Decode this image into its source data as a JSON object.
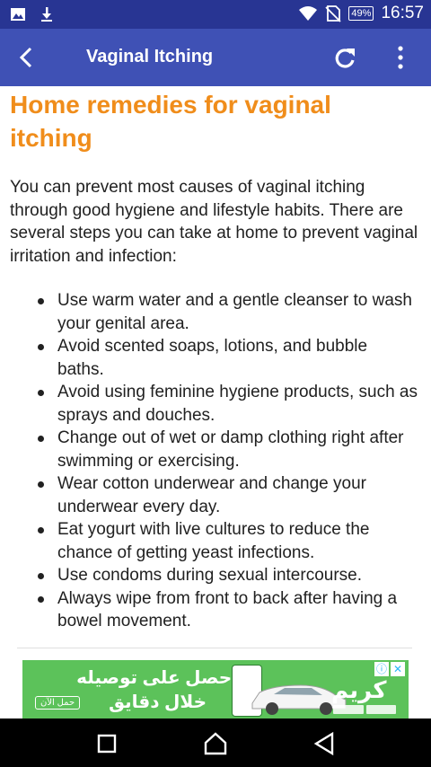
{
  "status_bar": {
    "time": "16:57",
    "battery": "49%",
    "icons": [
      "image-icon",
      "download-icon",
      "wifi-icon",
      "no-sim-icon",
      "battery-icon"
    ]
  },
  "app_bar": {
    "title": "Vaginal Itching",
    "icons": [
      "back-arrow-icon",
      "refresh-icon",
      "more-vert-icon"
    ]
  },
  "article": {
    "heading": "Home remedies for vaginal itching",
    "intro": "You can prevent most causes of vaginal itching through good hygiene and lifestyle habits. There are several steps you can take at home to prevent vaginal irritation and infection:",
    "remedies": [
      "Use warm water and a gentle cleanser to wash your genital area.",
      "Avoid scented soaps, lotions, and bubble baths.",
      "Avoid using feminine hygiene products, such as sprays and douches.",
      "Change out of wet or damp clothing right after swimming or exercising.",
      "Wear cotton underwear and change your underwear every day.",
      "Eat yogurt with live cultures to reduce the chance of getting yeast infections.",
      "Use condoms during sexual intercourse.",
      "Always wipe from front to back after having a bowel movement."
    ]
  },
  "ad": {
    "line1": "احصل على توصيله",
    "line2": "خلال دقايق",
    "cta": "حمل الآن",
    "brand": "كريم",
    "background": "#5cc25a"
  },
  "nav_bar": {
    "icons": [
      "recent-apps-icon",
      "home-icon",
      "back-icon"
    ]
  },
  "colors": {
    "status_bar": "#283593",
    "app_bar": "#3f51b5",
    "heading": "#f08d1b",
    "text": "#212121"
  }
}
